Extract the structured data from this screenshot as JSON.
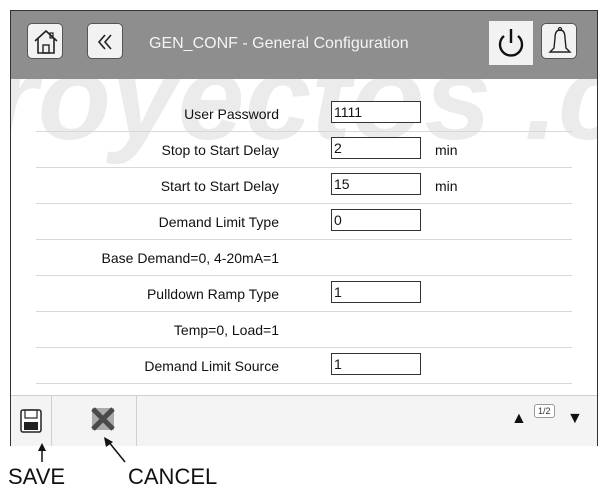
{
  "header": {
    "title": "GEN_CONF - General Configuration"
  },
  "watermark": {
    "text": "royectos .com"
  },
  "settings": [
    {
      "label": "User Password",
      "value": "1111",
      "unit": ""
    },
    {
      "label": "Stop to Start Delay",
      "value": "2",
      "unit": "min"
    },
    {
      "label": "Start to Start Delay",
      "value": "15",
      "unit": "min"
    },
    {
      "label": "Demand Limit Type",
      "value": "0",
      "unit": ""
    },
    {
      "label": "Base Demand=0, 4-20mA=1",
      "value": "",
      "unit": ""
    },
    {
      "label": "Pulldown Ramp Type",
      "value": "1",
      "unit": ""
    },
    {
      "label": "Temp=0, Load=1",
      "value": "",
      "unit": ""
    },
    {
      "label": "Demand Limit Source",
      "value": "1",
      "unit": ""
    }
  ],
  "footer": {
    "page_indicator": "1/2"
  },
  "annotations": {
    "save": "SAVE",
    "cancel": "CANCEL"
  },
  "colors": {
    "header_bg": "#8e8e8e",
    "button_bg": "#f2f2f2",
    "cancel_x": "#4a4a4a"
  },
  "icons": [
    "home-icon",
    "back-icon",
    "power-icon",
    "bell-icon",
    "save-icon",
    "cancel-icon",
    "up-arrow-icon",
    "down-arrow-icon"
  ]
}
